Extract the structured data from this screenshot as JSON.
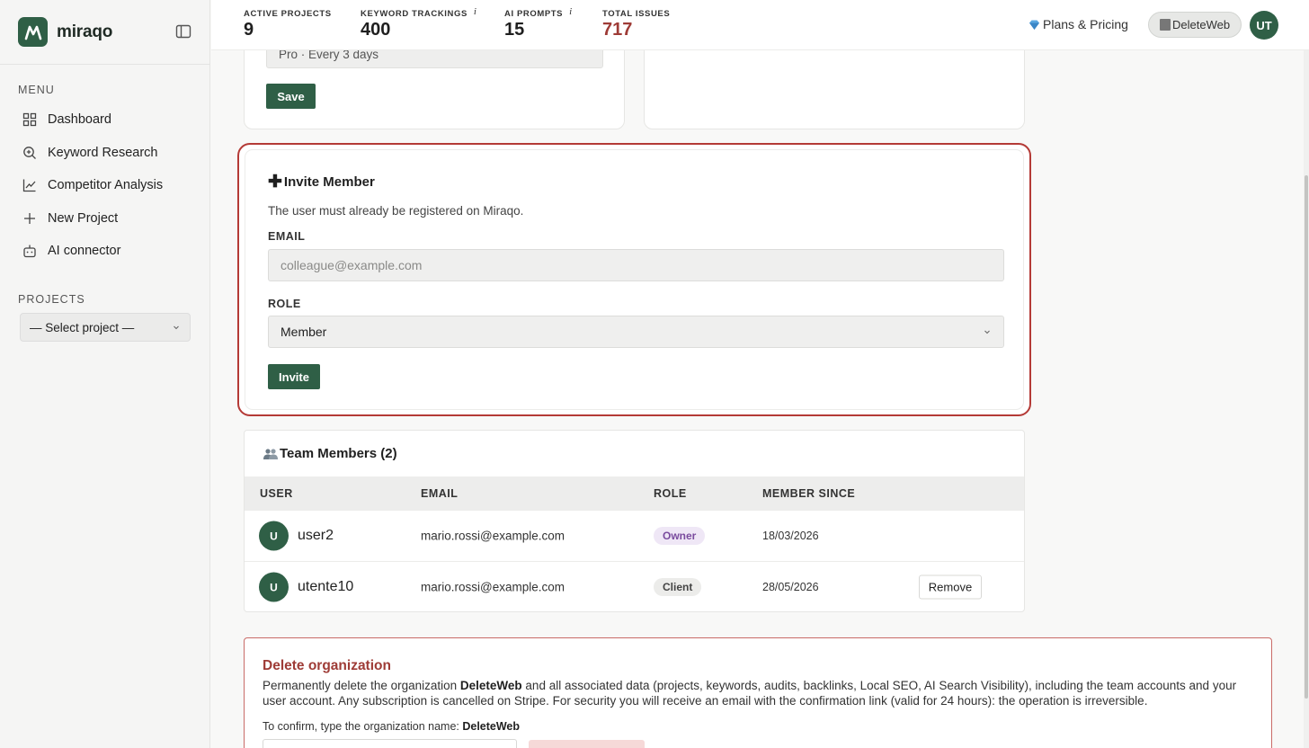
{
  "brand": {
    "name": "miraqo"
  },
  "sidebar": {
    "menu_label": "MENU",
    "items": [
      {
        "label": "Dashboard",
        "icon": "grid-icon"
      },
      {
        "label": "Keyword Research",
        "icon": "search-icon"
      },
      {
        "label": "Competitor Analysis",
        "icon": "chart-line-icon"
      },
      {
        "label": "New Project",
        "icon": "plus-icon"
      },
      {
        "label": "AI connector",
        "icon": "robot-icon"
      }
    ],
    "projects_label": "PROJECTS",
    "project_select": "— Select project —"
  },
  "topbar": {
    "stats": [
      {
        "label": "ACTIVE PROJECTS",
        "value": "9"
      },
      {
        "label": "KEYWORD TRACKINGS",
        "value": "400",
        "info": "i"
      },
      {
        "label": "AI PROMPTS",
        "value": "15",
        "info": "i"
      },
      {
        "label": "TOTAL ISSUES",
        "value": "717"
      }
    ],
    "plans_label": "Plans & Pricing",
    "org_name": "DeleteWeb",
    "avatar_initials": "UT"
  },
  "plan_card": {
    "plan_value": "Pro · Every 3 days",
    "save_label": "Save"
  },
  "invite": {
    "title": "Invite Member",
    "plus": "✚",
    "description": "The user must already be registered on Miraqo.",
    "email_label": "EMAIL",
    "email_placeholder": "colleague@example.com",
    "role_label": "ROLE",
    "role_value": "Member",
    "invite_label": "Invite"
  },
  "team": {
    "title": "Team Members (2)",
    "columns": [
      "USER",
      "EMAIL",
      "ROLE",
      "MEMBER SINCE"
    ],
    "rows": [
      {
        "initial": "U",
        "user": "user2",
        "email": "mario.rossi@example.com",
        "role": "Owner",
        "since": "18/03/2026"
      },
      {
        "initial": "U",
        "user": "utente10",
        "email": "mario.rossi@example.com",
        "role": "Client",
        "since": "28/05/2026",
        "action": "Remove"
      }
    ]
  },
  "danger": {
    "title": "Delete organization",
    "text_1": "Permanently delete the organization ",
    "org": "DeleteWeb",
    "text_2": " and all associated data (projects, keywords, audits, backlinks, Local SEO, AI Search Visibility), including the team accounts and your user account. Any subscription is cancelled on Stripe. For security you will receive an email with the confirmation link (valid for 24 hours): the operation is irreversible.",
    "confirm_label": "To confirm, type the organization name: ",
    "confirm_org": "DeleteWeb"
  },
  "colors": {
    "brand": "#2f5f46",
    "danger": "#9e3b36",
    "highlight_border": "#b43a36"
  }
}
